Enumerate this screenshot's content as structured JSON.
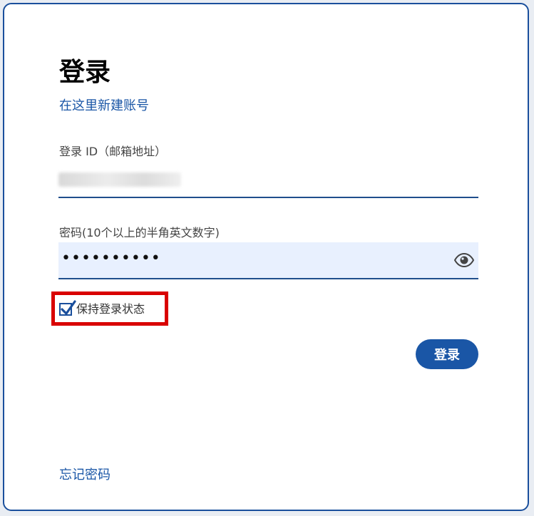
{
  "login_form": {
    "title": "登录",
    "create_account_link": "在这里新建账号",
    "id_label": "登录 ID（邮箱地址）",
    "password_label": "密码(10个以上的半角英文数字)",
    "password_value": "••••••••••",
    "remember_label": "保持登录状态",
    "remember_checked": true,
    "login_button": "登录",
    "forgot_password_link": "忘记密码"
  },
  "icons": {
    "eye": "eye-icon",
    "check": "checkmark-icon"
  },
  "colors": {
    "brand_blue": "#1a56a6",
    "highlight_red": "#d90000",
    "password_field_bg": "#e8f0fe"
  }
}
